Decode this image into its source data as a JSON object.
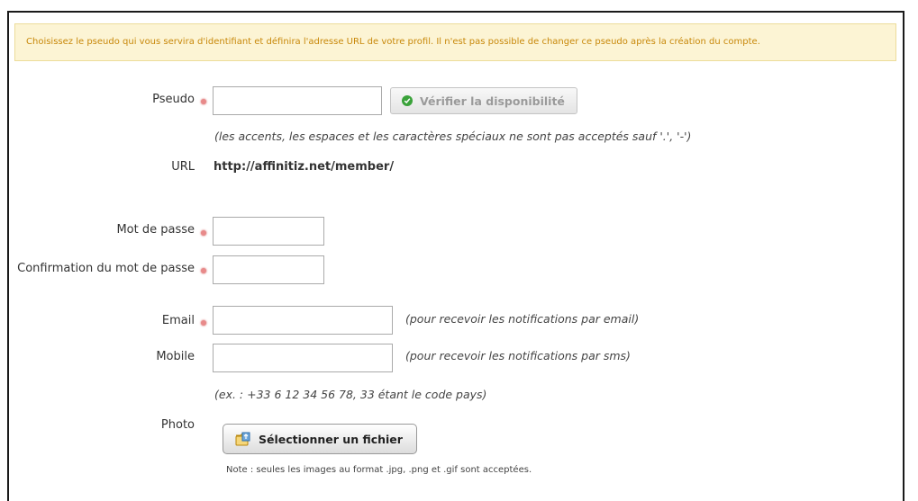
{
  "notice": "Choisissez le pseudo qui vous servira d'identifiant et définira l'adresse URL de votre profil. Il n'est pas possible de changer ce pseudo après la création du compte.",
  "fields": {
    "pseudo": {
      "label": "Pseudo",
      "value": "",
      "required": true
    },
    "password": {
      "label": "Mot de passe",
      "value": "",
      "required": true
    },
    "password_confirm": {
      "label": "Confirmation du mot de passe",
      "value": "",
      "required": true
    },
    "email": {
      "label": "Email",
      "value": "",
      "required": true
    },
    "mobile": {
      "label": "Mobile",
      "value": "",
      "required": false
    },
    "photo": {
      "label": "Photo"
    }
  },
  "buttons": {
    "check_availability": "Vérifier la disponibilité",
    "select_file": "Sélectionner un fichier"
  },
  "hints": {
    "pseudo": "(les accents, les espaces et les caractères spéciaux ne sont pas acceptés sauf '.', '-')",
    "email": "(pour recevoir les notifications par email)",
    "mobile": "(pour recevoir les notifications par sms)",
    "mobile_example": "(ex. : +33 6 12 34 56 78, 33 étant le code pays)",
    "photo_note": "Note : seules les images au format .jpg, .png et .gif sont acceptées."
  },
  "url": {
    "label": "URL",
    "value": "http://affinitiz.net/member/"
  },
  "colors": {
    "notice_bg": "#fcf4d4",
    "notice_text": "#c8880a",
    "required_marker": "#e88a8a",
    "check_icon": "#3aa23a"
  },
  "icons": {
    "check": "check-circle-icon",
    "file": "folder-upload-icon",
    "required": "required-dot-icon"
  }
}
